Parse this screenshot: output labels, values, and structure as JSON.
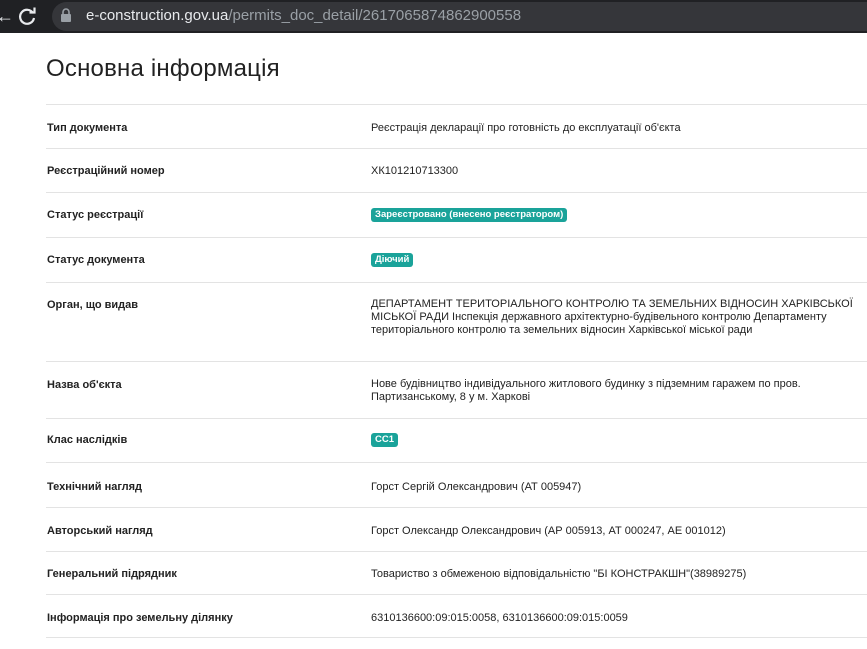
{
  "browser": {
    "url_host": "e-construction.gov.ua",
    "url_path": "/permits_doc_detail/2617065874862900558"
  },
  "page": {
    "title": "Основна інформація"
  },
  "rows": [
    {
      "label": "Тип документа",
      "value": "Реєстрація декларації про готовність до експлуатації об'єкта"
    },
    {
      "label": "Реєстраційний номер",
      "value": "ХК101210713300"
    },
    {
      "label": "Статус реєстрації",
      "value": "Зареєстровано (внесено реєстратором)"
    },
    {
      "label": "Статус документа",
      "value": "Діючий"
    },
    {
      "label": "Орган, що видав",
      "value": "ДЕПАРТАМЕНТ ТЕРИТОРІАЛЬНОГО КОНТРОЛЮ ТА ЗЕМЕЛЬНИХ ВІДНОСИН ХАРКІВСЬКОЇ МІСЬКОЇ РАДИ Інспекція державного архітектурно-будівельного контролю Департаменту територіального контролю та земельних відносин Харківської міської ради"
    },
    {
      "label": "Назва об'єкта",
      "value": "Нове будівництво індивідуального житлового будинку з підземним гаражем по пров. Партизанському, 8 у м. Харкові"
    },
    {
      "label": "Клас наслідків",
      "value": "СС1"
    },
    {
      "label": "Технічний нагляд",
      "value": "Горст Сергій Олександрович (АТ 005947)"
    },
    {
      "label": "Авторський нагляд",
      "value": "Горст Олександр Олександрович (АР 005913, АТ 000247, АЕ 001012)"
    },
    {
      "label": "Генеральний підрядник",
      "value": "Товариство з обмеженою відповідальністю \"БІ КОНСТРАКШН\"(38989275)"
    },
    {
      "label": "Інформація про земельну ділянку",
      "value": "6310136600:09:015:0058, 6310136600:09:015:0059"
    }
  ],
  "colors": {
    "badge": "#1aa39a",
    "browser_bar": "#202124"
  }
}
